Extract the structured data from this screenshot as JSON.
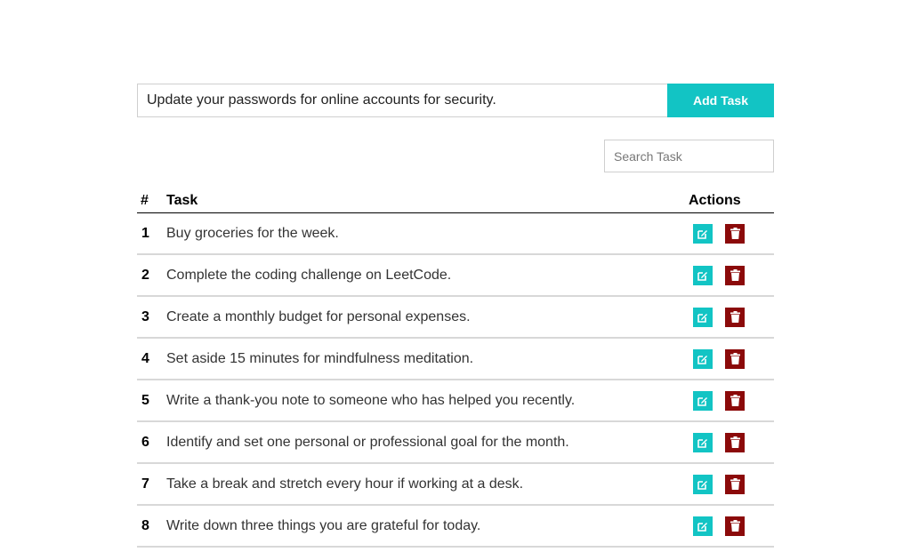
{
  "new_task": {
    "value": "Update your passwords for online accounts for security.",
    "add_button_label": "Add Task"
  },
  "search": {
    "placeholder": "Search Task",
    "value": ""
  },
  "table": {
    "headers": {
      "number": "#",
      "task": "Task",
      "actions": "Actions"
    },
    "rows": [
      {
        "number": "1",
        "task": "Buy groceries for the week."
      },
      {
        "number": "2",
        "task": "Complete the coding challenge on LeetCode."
      },
      {
        "number": "3",
        "task": "Create a monthly budget for personal expenses."
      },
      {
        "number": "4",
        "task": "Set aside 15 minutes for mindfulness meditation."
      },
      {
        "number": "5",
        "task": "Write a thank-you note to someone who has helped you recently."
      },
      {
        "number": "6",
        "task": "Identify and set one personal or professional goal for the month."
      },
      {
        "number": "7",
        "task": "Take a break and stretch every hour if working at a desk."
      },
      {
        "number": "8",
        "task": "Write down three things you are grateful for today."
      }
    ],
    "row_actions": [
      {
        "icon": "edit-icon",
        "color": "#12c4c4"
      },
      {
        "icon": "trash-icon",
        "color": "#8b0a0a"
      }
    ]
  },
  "colors": {
    "accent": "#12c4c4",
    "danger": "#8b0a0a"
  }
}
